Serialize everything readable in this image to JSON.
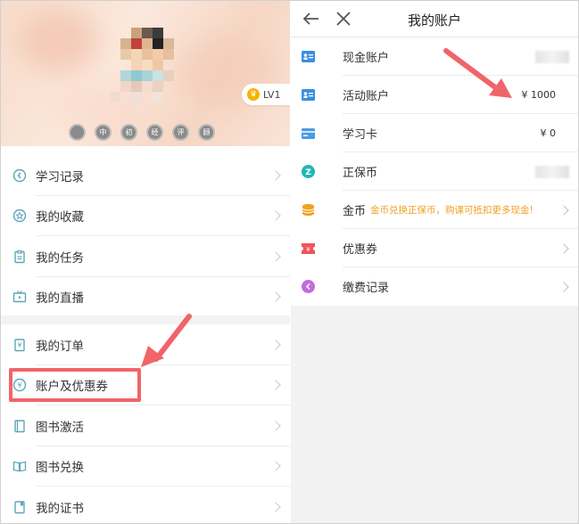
{
  "left_panel": {
    "level_badge": "LV1",
    "achievement_badges": [
      "",
      "中",
      "初",
      "经",
      "评",
      "顾"
    ],
    "menu_group_1": [
      {
        "label": "学习记录",
        "icon": "clock-icon"
      },
      {
        "label": "我的收藏",
        "icon": "star-icon"
      },
      {
        "label": "我的任务",
        "icon": "clipboard-icon"
      },
      {
        "label": "我的直播",
        "icon": "tv-icon"
      }
    ],
    "menu_group_2": [
      {
        "label": "我的订单",
        "icon": "order-icon"
      },
      {
        "label": "账户及优惠券",
        "icon": "yen-icon"
      },
      {
        "label": "图书激活",
        "icon": "book-activate-icon"
      },
      {
        "label": "图书兑换",
        "icon": "book-exchange-icon"
      },
      {
        "label": "我的证书",
        "icon": "certificate-icon"
      }
    ]
  },
  "right_panel": {
    "title": "我的账户",
    "accounts": [
      {
        "label": "现金账户",
        "value": "",
        "icon": "id-card-icon",
        "color": "#3b8fe0"
      },
      {
        "label": "活动账户",
        "value": "¥ 1000",
        "icon": "id-card-icon",
        "color": "#3b8fe0"
      },
      {
        "label": "学习卡",
        "value": "¥ 0",
        "icon": "card-icon",
        "color": "#4a9be8"
      },
      {
        "label": "正保币",
        "value": "",
        "icon": "z-coin-icon",
        "color": "#20b7b0"
      },
      {
        "label": "金币",
        "note": "金币兑换正保币，购课可抵扣更多现金!",
        "icon": "gold-coin-icon",
        "color": "#f3a21f"
      },
      {
        "label": "优惠券",
        "icon": "coupon-icon",
        "color": "#f0555a"
      },
      {
        "label": "缴费记录",
        "icon": "payment-record-icon",
        "color": "#c46cd8"
      }
    ]
  },
  "colors": {
    "annotation": "#f0656a",
    "accent_teal": "#5aa7b8"
  }
}
